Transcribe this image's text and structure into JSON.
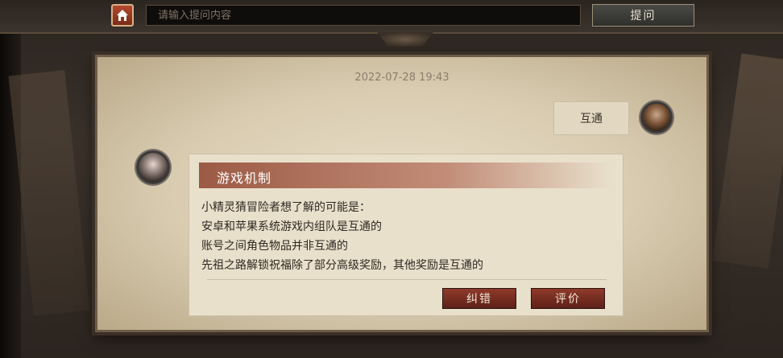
{
  "search": {
    "placeholder": "请输入提问内容",
    "ask_label": "提问"
  },
  "chat": {
    "timestamp": "2022-07-28 19:43",
    "user_message": "互通",
    "answer": {
      "title": "游戏机制",
      "lines": [
        "小精灵猜冒险者想了解的可能是：",
        "安卓和苹果系统游戏内组队是互通的",
        "账号之间角色物品并非互通的",
        "先祖之路解锁祝福除了部分高级奖励，其他奖励是互通的"
      ],
      "correct_label": "纠错",
      "rate_label": "评价"
    }
  },
  "icons": {
    "home": "home-icon"
  },
  "colors": {
    "accent_red": "#8e3a2a",
    "header_red": "#9c5a45",
    "paper": "#e9e0cc"
  }
}
